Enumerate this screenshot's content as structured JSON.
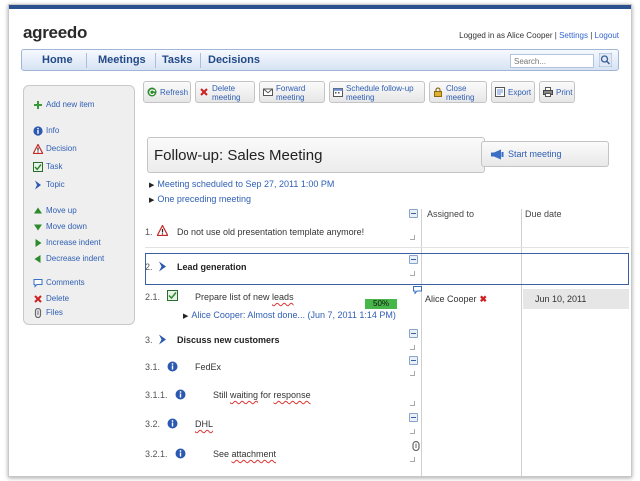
{
  "app": {
    "logo": "agreedo",
    "logged_in_text": "Logged in as Alice Cooper |",
    "settings_link": "Settings",
    "separator": "|",
    "logout_link": "Logout"
  },
  "nav": {
    "items": [
      "Home",
      "Meetings",
      "Tasks",
      "Decisions"
    ],
    "search_placeholder": "Search..."
  },
  "sidebar": {
    "add_new_item": "Add new item",
    "types": [
      "Info",
      "Decision",
      "Task",
      "Topic"
    ],
    "actions": [
      "Move up",
      "Move down",
      "Increase indent",
      "Decrease indent"
    ],
    "extras": [
      "Comments",
      "Delete",
      "Files"
    ]
  },
  "toolbar": {
    "refresh": "Refresh",
    "delete_l1": "Delete",
    "delete_l2": "meeting",
    "forward_l1": "Forward",
    "forward_l2": "meeting",
    "schedule_l1": "Schedule follow-up",
    "schedule_l2": "meeting",
    "close_l1": "Close",
    "close_l2": "meeting",
    "export": "Export",
    "print": "Print"
  },
  "meeting": {
    "title": "Follow-up: Sales Meeting",
    "start_button": "Start meeting",
    "scheduled_link": "Meeting scheduled to Sep 27, 2011 1:00 PM",
    "preceding_link": "One preceding meeting"
  },
  "columns": {
    "assigned_to": "Assigned to",
    "due_date": "Due date"
  },
  "rows": [
    {
      "num": "1.",
      "text": "Do not use old presentation template anymore!"
    },
    {
      "num": "2.",
      "text": "Lead generation"
    },
    {
      "num": "2.1.",
      "text_pre": "Prepare list of new ",
      "text_err": "leads",
      "progress": 50,
      "progress_label": "50%",
      "assigned": "Alice Cooper",
      "assigned_mark": "✖",
      "due": "Jun 10, 2011",
      "comment": "Alice Cooper: Almost done... (Jun 7, 2011 1:14 PM)"
    },
    {
      "num": "3.",
      "text": "Discuss new customers"
    },
    {
      "num": "3.1.",
      "text": "FedEx"
    },
    {
      "num": "3.1.1.",
      "text_pre": "Still ",
      "text_err1": "waiting",
      "text_mid": " for ",
      "text_err2": "response"
    },
    {
      "num": "3.2.",
      "text_err": "DHL"
    },
    {
      "num": "3.2.1.",
      "text_pre": "See ",
      "text_err": "attachment"
    }
  ],
  "colors": {
    "link": "#2f5fb3",
    "nav_text": "#234a86",
    "progress": "#46b54a",
    "selection": "#3b5fa0",
    "danger": "#cc2222"
  }
}
